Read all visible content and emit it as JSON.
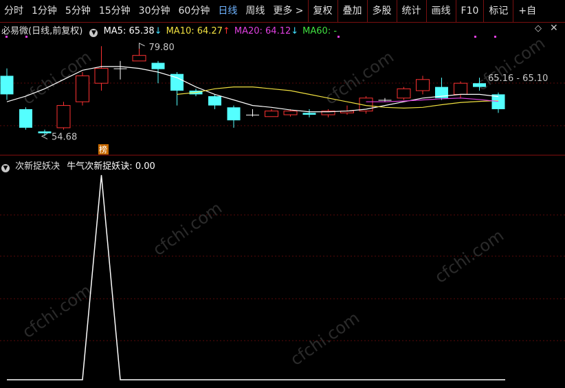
{
  "toolbar": {
    "periods": [
      "分时",
      "1分钟",
      "5分钟",
      "15分钟",
      "30分钟",
      "60分钟",
      "日线",
      "周线",
      "更多 >"
    ],
    "active_period": "日线",
    "actions": [
      "复权",
      "叠加",
      "多股",
      "统计",
      "画线",
      "F10",
      "标记",
      "+自"
    ]
  },
  "main_chart": {
    "title": "必易微(日线,前复权)",
    "ma": [
      {
        "label": "MA5:",
        "value": "65.38",
        "arrow": "↓",
        "color": "#ffffff"
      },
      {
        "label": "MA10:",
        "value": "64.27",
        "arrow": "↑",
        "color": "#f0e040"
      },
      {
        "label": "MA20:",
        "value": "64.12",
        "arrow": "↓",
        "color": "#e040e0"
      },
      {
        "label": "MA60:",
        "value": "-",
        "arrow": "",
        "color": "#40e040"
      }
    ],
    "high_label": "79.80",
    "low_label": "54.68",
    "price_range_label": "65.16 - 65.10",
    "badge": "榜",
    "y_range": [
      52,
      82
    ],
    "candles": [
      {
        "o": 71,
        "c": 66,
        "h": 73,
        "l": 64.5
      },
      {
        "o": 62,
        "c": 57,
        "h": 62.5,
        "l": 56.5
      },
      {
        "o": 56,
        "c": 55.5,
        "h": 56.5,
        "l": 54.7
      },
      {
        "o": 57,
        "c": 63,
        "h": 64,
        "l": 56.5
      },
      {
        "o": 64,
        "c": 71,
        "h": 72,
        "l": 63
      },
      {
        "o": 69,
        "c": 73,
        "h": 79,
        "l": 67
      },
      {
        "o": 73,
        "c": 73,
        "h": 75,
        "l": 70
      },
      {
        "o": 75,
        "c": 76.5,
        "h": 79.8,
        "l": 75
      },
      {
        "o": 74.5,
        "c": 72.8,
        "h": 75,
        "l": 69
      },
      {
        "o": 71.5,
        "c": 67,
        "h": 72,
        "l": 63
      },
      {
        "o": 67,
        "c": 66,
        "h": 67.5,
        "l": 65.5
      },
      {
        "o": 65.5,
        "c": 63,
        "h": 66,
        "l": 62
      },
      {
        "o": 62.5,
        "c": 59,
        "h": 63,
        "l": 57
      },
      {
        "o": 60.5,
        "c": 60.5,
        "h": 62,
        "l": 60
      },
      {
        "o": 60,
        "c": 61.5,
        "h": 62,
        "l": 60
      },
      {
        "o": 60.5,
        "c": 61.5,
        "h": 62,
        "l": 60
      },
      {
        "o": 61,
        "c": 60.5,
        "h": 62,
        "l": 59.8
      },
      {
        "o": 60.5,
        "c": 61.5,
        "h": 62,
        "l": 59.8
      },
      {
        "o": 61,
        "c": 61.5,
        "h": 63,
        "l": 60.5
      },
      {
        "o": 61.5,
        "c": 65,
        "h": 65.5,
        "l": 60.8
      },
      {
        "o": 64.5,
        "c": 64.5,
        "h": 65,
        "l": 64
      },
      {
        "o": 65,
        "c": 67.5,
        "h": 68,
        "l": 64.5
      },
      {
        "o": 67,
        "c": 70,
        "h": 71,
        "l": 66
      },
      {
        "o": 68,
        "c": 65,
        "h": 70.5,
        "l": 64.5
      },
      {
        "o": 66,
        "c": 69,
        "h": 69.5,
        "l": 65
      },
      {
        "o": 69,
        "c": 68,
        "h": 70.5,
        "l": 67
      },
      {
        "o": 66,
        "c": 62,
        "h": 66.5,
        "l": 61
      }
    ],
    "ma5": [
      64,
      65.5,
      67.5,
      70,
      72.5,
      73.5,
      73.5,
      73,
      72,
      70.5,
      68,
      66,
      64.5,
      63,
      62.5,
      61.8,
      61.3,
      61.3,
      61.5,
      62,
      63,
      64,
      65,
      65.5,
      66,
      66,
      65.4
    ],
    "ma10": [
      null,
      null,
      null,
      null,
      null,
      null,
      null,
      null,
      null,
      66,
      66.5,
      67.5,
      68,
      68,
      67.5,
      67,
      66,
      65,
      64,
      63,
      62.5,
      62.3,
      62.5,
      63.2,
      63.8,
      64.1,
      64.3
    ],
    "ma20": [
      null,
      null,
      null,
      null,
      null,
      null,
      null,
      null,
      null,
      null,
      null,
      null,
      null,
      null,
      null,
      null,
      null,
      null,
      null,
      64,
      64,
      64.2,
      64.5,
      64.8,
      65,
      64.6,
      64.1
    ]
  },
  "indicator": {
    "title": "次新捉妖决",
    "series_label": "牛气次新捉妖诀:",
    "value": "0.00",
    "values": [
      0,
      0,
      0,
      0,
      0,
      1,
      0,
      0,
      0,
      0,
      0,
      0,
      0,
      0,
      0,
      0,
      0,
      0,
      0,
      0,
      0,
      0,
      0,
      0,
      0,
      0,
      0
    ]
  },
  "watermark": "cfchi.com"
}
